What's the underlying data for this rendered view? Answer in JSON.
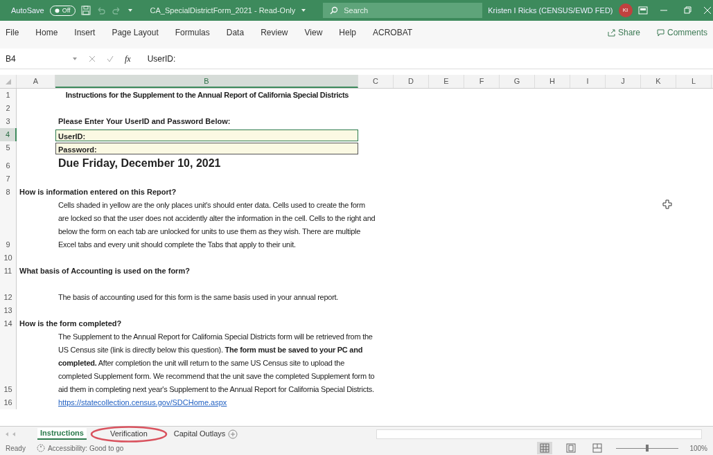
{
  "title_bar": {
    "autosave": {
      "label": "AutoSave",
      "state_label": "Off",
      "on": false
    },
    "document_title": "CA_SpecialDistrictForm_2021  -  Read-Only",
    "search": {
      "placeholder": "Search"
    },
    "user": {
      "name": "Kristen I Ricks (CENSUS/EWD FED)",
      "initials": "KI"
    }
  },
  "ribbon": {
    "tabs": [
      "File",
      "Home",
      "Insert",
      "Page Layout",
      "Formulas",
      "Data",
      "Review",
      "View",
      "Help",
      "ACROBAT"
    ],
    "share": "Share",
    "comments": "Comments"
  },
  "formula_bar": {
    "name_box": "B4",
    "function_label": "fx",
    "content": "UserID:"
  },
  "columns": [
    {
      "label": "A",
      "selected": false
    },
    {
      "label": "B",
      "selected": true
    },
    {
      "label": "C",
      "selected": false
    },
    {
      "label": "D",
      "selected": false
    },
    {
      "label": "E",
      "selected": false
    },
    {
      "label": "F",
      "selected": false
    },
    {
      "label": "G",
      "selected": false
    },
    {
      "label": "H",
      "selected": false
    },
    {
      "label": "I",
      "selected": false
    },
    {
      "label": "J",
      "selected": false
    },
    {
      "label": "K",
      "selected": false
    },
    {
      "label": "L",
      "selected": false
    }
  ],
  "rows": [
    {
      "number": "1",
      "selected": false,
      "kind": "title",
      "text": "Instructions for the Supplement to the Annual Report of California Special Districts"
    },
    {
      "number": "2",
      "selected": false,
      "kind": "blank"
    },
    {
      "number": "3",
      "selected": false,
      "kind": "label",
      "text": "Please  Enter Your UserID and Password Below:"
    },
    {
      "number": "4",
      "selected": true,
      "kind": "field",
      "text": "UserID:",
      "active": true
    },
    {
      "number": "5",
      "selected": false,
      "kind": "field",
      "text": "Password:",
      "active": false
    },
    {
      "number": "6",
      "selected": false,
      "kind": "due",
      "text": "Due Friday, December 10, 2021"
    },
    {
      "number": "7",
      "selected": false,
      "kind": "blank"
    },
    {
      "number": "8",
      "selected": false,
      "kind": "question",
      "text": "How is information entered on this Report?"
    },
    {
      "number": "9",
      "selected": false,
      "kind": "paragraph",
      "text": "Cells shaded in yellow are the only places unit's should enter data.  Cells used to create the form are locked so that the user does not accidently alter the information in the cell.  Cells to the right and below the form on each tab are unlocked for units to use them as they wish.  There are multiple Excel tabs and every unit should complete the Tabs that apply to their unit."
    },
    {
      "number": "10",
      "selected": false,
      "kind": "blank"
    },
    {
      "number": "11",
      "selected": false,
      "kind": "question",
      "text": "What basis of Accounting is used on the form?"
    },
    {
      "number": "12",
      "selected": false,
      "kind": "paragraph",
      "text": "The basis of accounting used for this form is the same basis used in your annual report."
    },
    {
      "number": "13",
      "selected": false,
      "kind": "blank"
    },
    {
      "number": "14",
      "selected": false,
      "kind": "question",
      "text": "How is the form completed?"
    },
    {
      "number": "15",
      "selected": false,
      "kind": "paragraph",
      "text": "The Supplement to the Annual Report for California Special Districts form will be retrieved from the US Census site (link is directly below this question).  **The form must be saved to your PC and completed.**  After completion the unit will return to the same US Census site to upload the completed Supplement form.  We recommend that the unit save the completed Supplement form to aid them in completing next year's Supplement to the Annual Report for California Special Districts."
    },
    {
      "number": "16",
      "selected": false,
      "kind": "link",
      "text": "https://statecollection.census.gov/SDCHome.aspx"
    }
  ],
  "sheet_tabs": [
    {
      "label": "Instructions",
      "selected": true,
      "circled": false
    },
    {
      "label": "Verification",
      "selected": false,
      "circled": true
    },
    {
      "label": "Capital Outlays",
      "selected": false,
      "circled": false
    }
  ],
  "status_bar": {
    "state": "Ready",
    "accessibility": "Accessibility: Good to go",
    "views": [
      {
        "kind": "normal",
        "selected": true
      },
      {
        "kind": "page_layout",
        "selected": false
      },
      {
        "kind": "page_break",
        "selected": false
      }
    ],
    "zoom": {
      "level": 0.5,
      "reading": "100%"
    }
  }
}
